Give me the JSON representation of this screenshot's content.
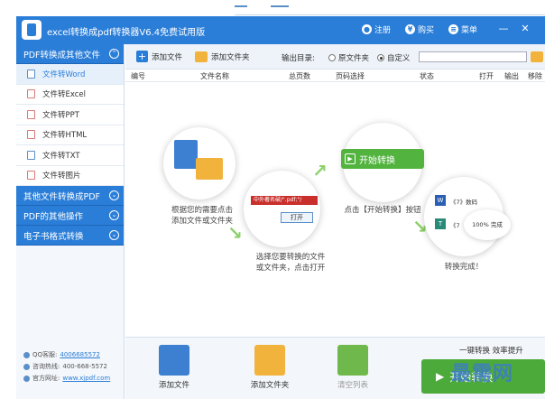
{
  "window": {
    "title": "excel转换成pdf转换器V6.4免费试用版",
    "actions": [
      {
        "label": "注册",
        "icon": "user-icon"
      },
      {
        "label": "购买",
        "icon": "yen-icon"
      },
      {
        "label": "菜单",
        "icon": "menu-icon"
      }
    ],
    "controls": [
      "minimize",
      "close"
    ]
  },
  "sidebar": {
    "section1": {
      "label": "PDF转换成其他文件"
    },
    "items": [
      {
        "label": "文件转Word",
        "icon": "word-file-icon"
      },
      {
        "label": "文件转Excel",
        "icon": "excel-file-icon"
      },
      {
        "label": "文件转PPT",
        "icon": "ppt-file-icon"
      },
      {
        "label": "文件转HTML",
        "icon": "html-file-icon"
      },
      {
        "label": "文件转TXT",
        "icon": "txt-file-icon"
      },
      {
        "label": "文件转图片",
        "icon": "image-file-icon"
      }
    ],
    "sections": [
      {
        "label": "其他文件转换成PDF"
      },
      {
        "label": "PDF的其他操作"
      },
      {
        "label": "电子书格式转换"
      }
    ],
    "contact": {
      "qq_label": "QQ客服:",
      "qq_value": "4006685572",
      "phone_label": "咨询热线:",
      "phone_value": "400-668-5572",
      "site_label": "官方网址:",
      "site_value": "www.xjpdf.com"
    }
  },
  "toolbar": {
    "add_file": "添加文件",
    "add_folder": "添加文件夹",
    "output_label": "输出目录:",
    "radio_original": "原文件夹",
    "radio_custom": "自定义",
    "path_value": ""
  },
  "table": {
    "headers": [
      "编号",
      "文件名称",
      "总页数",
      "页码选择",
      "状态",
      "打开",
      "输出",
      "移除"
    ]
  },
  "guide": {
    "step1": "根据您的需要点击\n添加文件或文件夹",
    "step2": "选择您要转换的文件\n或文件夹，点击打开",
    "step2_title": "中外著名破",
    "step2_suffix": "/\".pdf;\"/",
    "step2_open": "打开",
    "step3": "点击【开始转换】按钮",
    "step3_button": "开始转换",
    "step4": "转换完成！",
    "step4_row1": "《7》数码",
    "step4_row2": "《7",
    "step4_percent": "100%",
    "step4_done": "完成"
  },
  "bottom": {
    "add_file": "添加文件",
    "add_folder": "添加文件夹",
    "clear_list": "清空列表",
    "slogan": "一键转换  效率提升",
    "start": "开始转换"
  },
  "watermark": "最需网",
  "colors": {
    "accent": "#2b7ed8",
    "green": "#52b33e",
    "folder": "#f2b33d"
  }
}
